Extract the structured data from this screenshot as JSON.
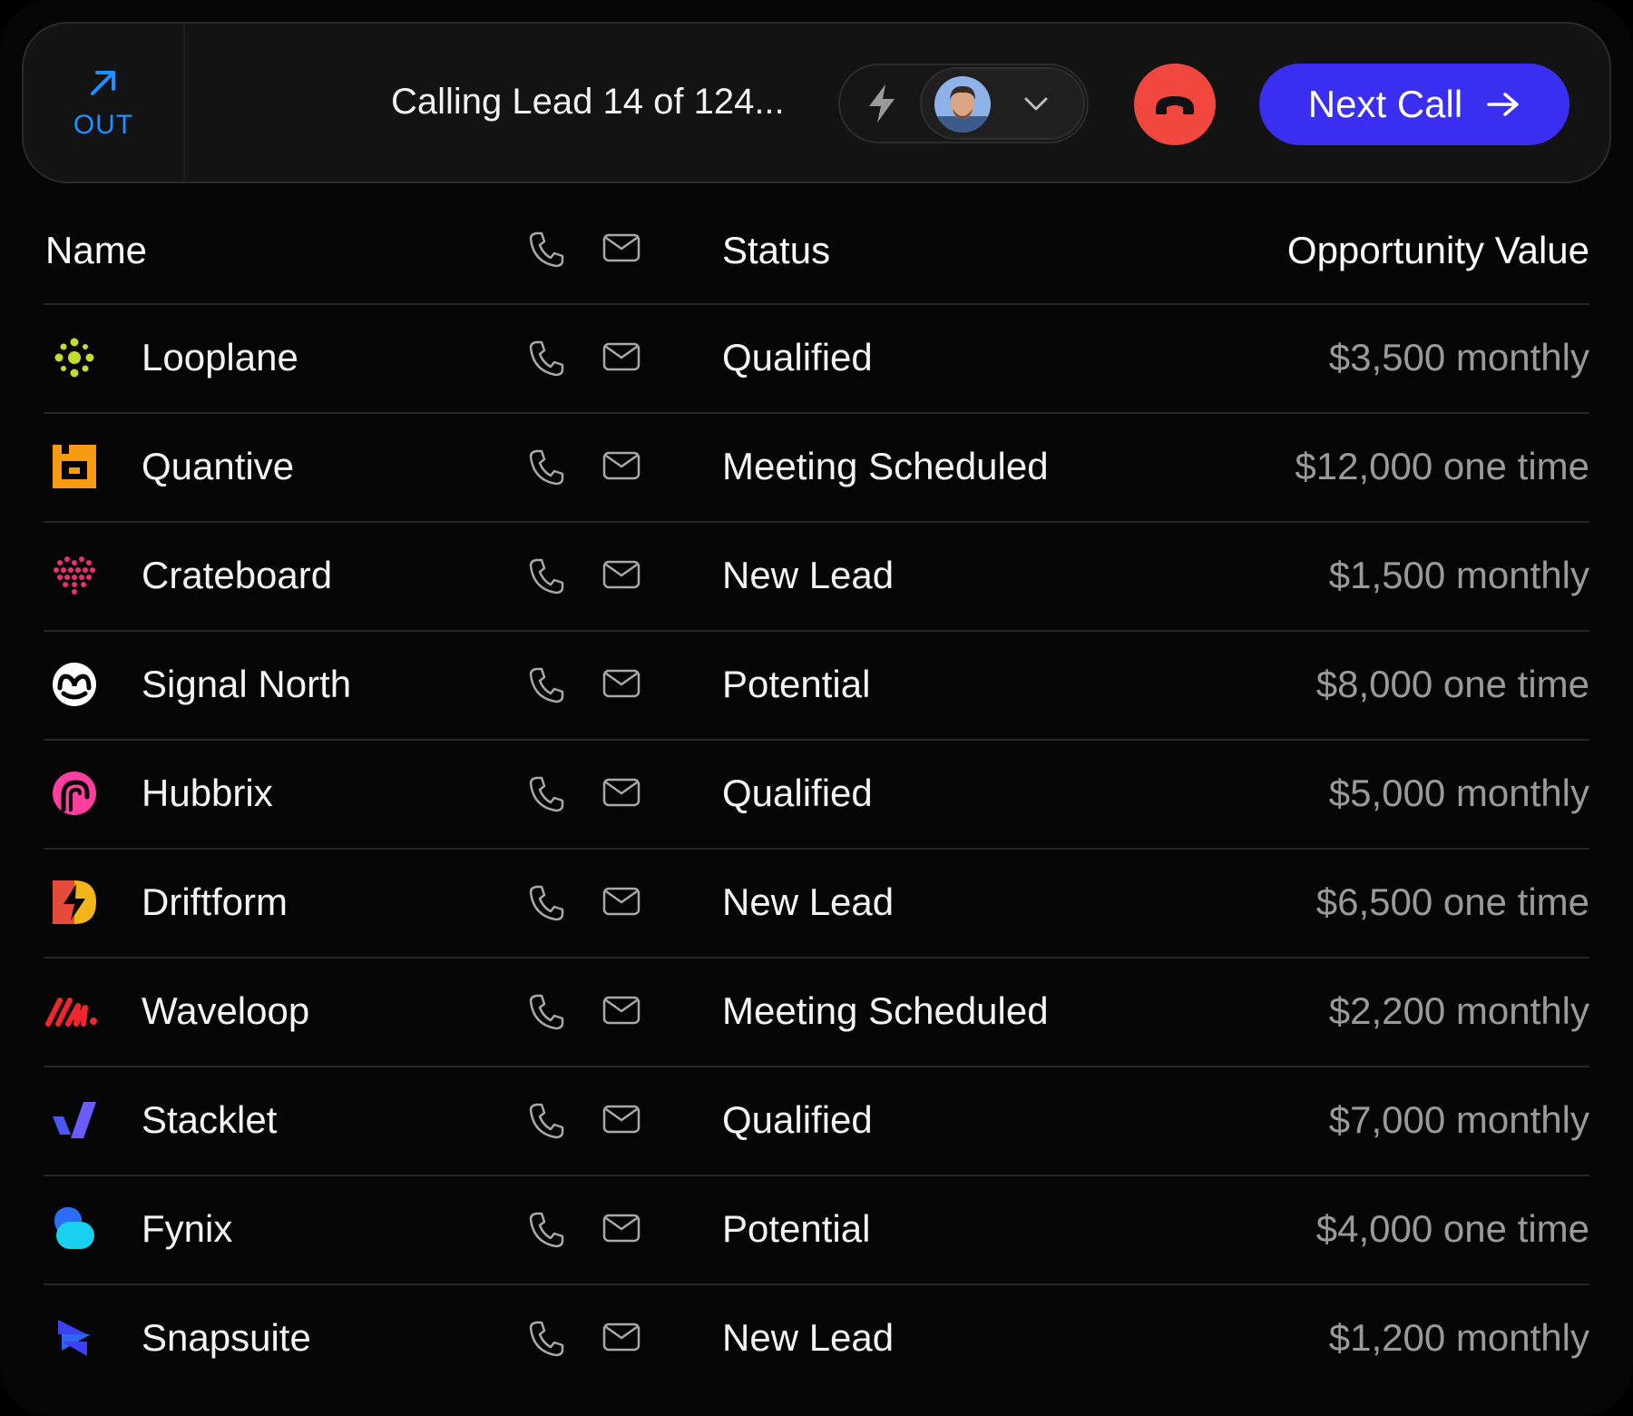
{
  "call_bar": {
    "direction_label": "OUT",
    "calling_text": "Calling Lead 14 of 124...",
    "next_call_label": "Next Call"
  },
  "table": {
    "headers": {
      "name": "Name",
      "status": "Status",
      "value": "Opportunity Value"
    },
    "rows": [
      {
        "name": "Looplane",
        "status": "Qualified",
        "value": "$3,500 monthly",
        "logo": "looplane-logo"
      },
      {
        "name": "Quantive",
        "status": "Meeting Scheduled",
        "value": "$12,000 one time",
        "logo": "quantive-logo"
      },
      {
        "name": "Crateboard",
        "status": "New Lead",
        "value": "$1,500 monthly",
        "logo": "crateboard-logo"
      },
      {
        "name": "Signal North",
        "status": "Potential",
        "value": "$8,000 one time",
        "logo": "signal-north-logo"
      },
      {
        "name": "Hubbrix",
        "status": "Qualified",
        "value": "$5,000 monthly",
        "logo": "hubbrix-logo"
      },
      {
        "name": "Driftform",
        "status": "New Lead",
        "value": "$6,500 one time",
        "logo": "driftform-logo"
      },
      {
        "name": "Waveloop",
        "status": "Meeting Scheduled",
        "value": "$2,200 monthly",
        "logo": "waveloop-logo"
      },
      {
        "name": "Stacklet",
        "status": "Qualified",
        "value": "$7,000 monthly",
        "logo": "stacklet-logo"
      },
      {
        "name": "Fynix",
        "status": "Potential",
        "value": "$4,000 one time",
        "logo": "fynix-logo"
      },
      {
        "name": "Snapsuite",
        "status": "New Lead",
        "value": "$1,200 monthly",
        "logo": "snapsuite-logo"
      }
    ]
  },
  "colors": {
    "direction_accent": "#1e90ff",
    "hangup": "#f2473f",
    "next_call": "#3a2ef0"
  }
}
